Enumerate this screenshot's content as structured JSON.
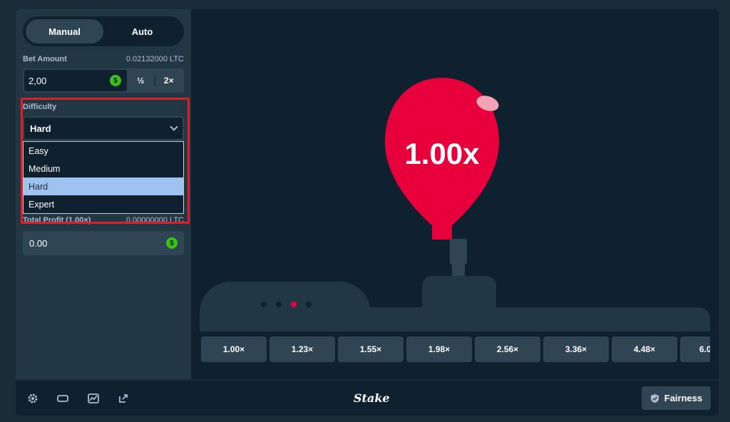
{
  "sidebar": {
    "modes": [
      {
        "label": "Manual",
        "active": true
      },
      {
        "label": "Auto",
        "active": false
      }
    ],
    "bet_amount": {
      "label": "Bet Amount",
      "ltc_value": "0.02132000 LTC",
      "value": "2,00",
      "half_label": "½",
      "double_label": "2×"
    },
    "difficulty": {
      "label": "Difficulty",
      "selected": "Hard",
      "options": [
        "Easy",
        "Medium",
        "Hard",
        "Expert"
      ],
      "highlighted_option": "Hard"
    },
    "total_profit": {
      "label": "Total Profit (1.00×)",
      "ltc_value": "0.00000000 LTC",
      "value": "0.00"
    }
  },
  "game": {
    "current_multiplier": "1.00x",
    "multipliers": [
      "1.00×",
      "1.23×",
      "1.55×",
      "1.98×",
      "2.56×",
      "3.36×",
      "4.48×",
      "6.0"
    ],
    "active_dot_index": 2,
    "balloon_color": "#e7003b"
  },
  "footer": {
    "icons": [
      "gear-icon",
      "screen-icon",
      "chart-icon",
      "popout-icon"
    ],
    "logo": "Stake",
    "fairness_label": "Fairness"
  },
  "colors": {
    "accent_green": "#3bc117",
    "highlight_red": "#e11d27",
    "panel": "#213743",
    "background": "#0f212e"
  }
}
